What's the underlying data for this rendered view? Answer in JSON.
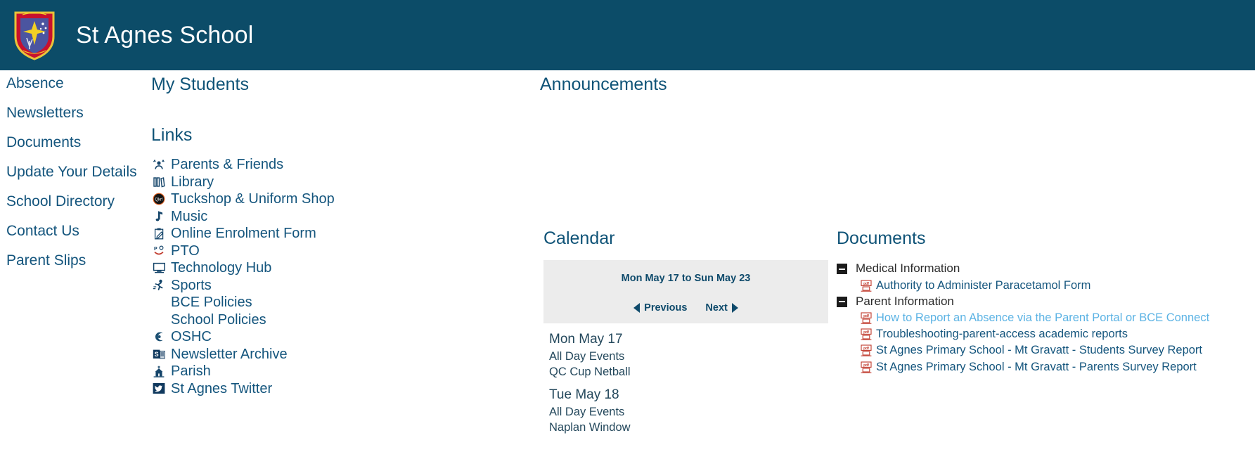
{
  "header": {
    "title": "St Agnes School",
    "logo_name": "school-crest",
    "background_color": "#0c4c68"
  },
  "sidebar": {
    "items": [
      {
        "label": "Absence"
      },
      {
        "label": "Newsletters"
      },
      {
        "label": "Documents"
      },
      {
        "label": "Update Your Details"
      },
      {
        "label": "School Directory"
      },
      {
        "label": "Contact Us"
      },
      {
        "label": "Parent Slips"
      }
    ]
  },
  "my_students": {
    "title": "My Students"
  },
  "links": {
    "title": "Links",
    "items": [
      {
        "label": "Parents & Friends",
        "icon": "people-icon"
      },
      {
        "label": "Library",
        "icon": "books-icon"
      },
      {
        "label": "Tuckshop & Uniform Shop",
        "icon": "qkr-circle-icon"
      },
      {
        "label": "Music",
        "icon": "music-note-icon"
      },
      {
        "label": "Online Enrolment Form",
        "icon": "clipboard-pencil-icon"
      },
      {
        "label": "PTO",
        "icon": "pto-icon"
      },
      {
        "label": "Technology Hub",
        "icon": "monitor-icon"
      },
      {
        "label": "Sports",
        "icon": "runner-icon"
      },
      {
        "label": "BCE Policies",
        "icon": "none"
      },
      {
        "label": "School Policies",
        "icon": "none"
      },
      {
        "label": "OSHC",
        "icon": "oshc-icon"
      },
      {
        "label": "Newsletter Archive",
        "icon": "sharepoint-icon"
      },
      {
        "label": "Parish",
        "icon": "church-icon"
      },
      {
        "label": "St Agnes Twitter",
        "icon": "twitter-icon"
      }
    ]
  },
  "announcements": {
    "title": "Announcements"
  },
  "calendar": {
    "title": "Calendar",
    "range": "Mon May 17 to Sun May 23",
    "previous_label": "Previous",
    "next_label": "Next",
    "days": [
      {
        "date": "Mon May 17",
        "section": "All Day Events",
        "events": [
          "QC Cup Netball"
        ]
      },
      {
        "date": "Tue May 18",
        "section": "All Day Events",
        "events": [
          "Naplan Window"
        ]
      }
    ]
  },
  "documents": {
    "title": "Documents",
    "folders": [
      {
        "name": "Medical Information",
        "expanded": true,
        "files": [
          {
            "name": "Authority to Administer Paracetamol Form",
            "icon": "pdf-icon",
            "highlight": false
          }
        ]
      },
      {
        "name": "Parent Information",
        "expanded": true,
        "files": [
          {
            "name": "How to Report an Absence via the Parent Portal or BCE Connect",
            "icon": "pdf-icon",
            "highlight": true
          },
          {
            "name": "Troubleshooting-parent-access academic reports",
            "icon": "pdf-icon",
            "highlight": false
          },
          {
            "name": "St Agnes Primary School - Mt Gravatt - Students Survey Report",
            "icon": "pdf-icon",
            "highlight": false
          },
          {
            "name": "St Agnes Primary School - Mt Gravatt - Parents Survey Report",
            "icon": "pdf-icon",
            "highlight": false
          }
        ]
      }
    ]
  },
  "colors": {
    "header_bg": "#0c4c68",
    "link_blue": "#14557d",
    "highlight_blue": "#5cb3e4",
    "panel_gray": "#ececec"
  }
}
